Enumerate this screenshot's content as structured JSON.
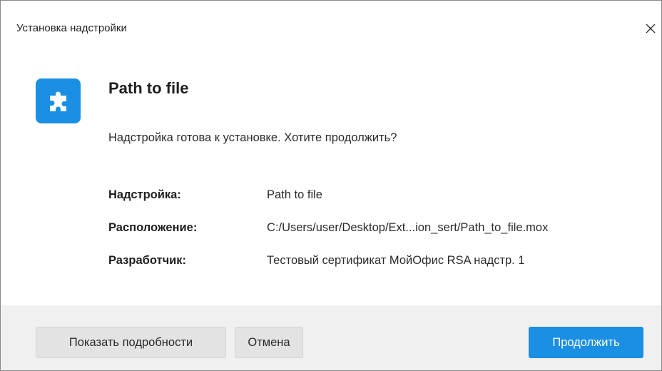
{
  "window": {
    "title": "Установка надстройки",
    "close_icon": "close-icon"
  },
  "addin": {
    "icon": "puzzle-piece-icon",
    "icon_color": "#1a8fe3",
    "name": "Path to file",
    "message": "Надстройка готова к установке. Хотите продолжить?"
  },
  "details": [
    {
      "label": "Надстройка:",
      "value": "Path to file"
    },
    {
      "label": "Расположение:",
      "value": "C:/Users/user/Desktop/Ext...ion_sert/Path_to_file.mox"
    },
    {
      "label": "Разработчик:",
      "value": "Тестовый сертификат МойОфис RSA надстр. 1"
    }
  ],
  "buttons": {
    "details_label": "Показать подробности",
    "cancel_label": "Отмена",
    "continue_label": "Продолжить"
  },
  "colors": {
    "accent": "#1a8fe3",
    "footer_bg": "#f0f0f0",
    "secondary_button_bg": "#e3e3e3"
  }
}
